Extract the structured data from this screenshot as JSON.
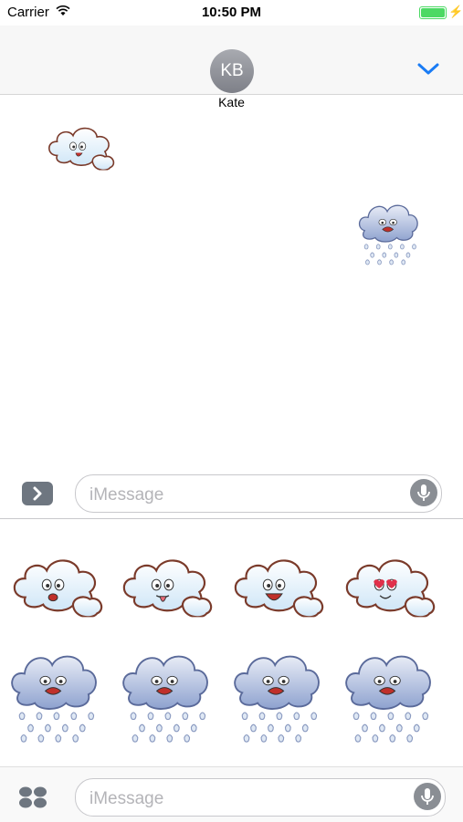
{
  "status_bar": {
    "carrier": "Carrier",
    "time": "10:50 PM"
  },
  "header": {
    "avatar_initials": "KB",
    "contact_name": "Kate"
  },
  "conversation": {
    "messages": [
      {
        "type": "sticker",
        "sender": "other",
        "icon": "cloud-puffing-sticker"
      },
      {
        "type": "sticker",
        "sender": "me",
        "icon": "rain-cloud-crying-sticker"
      }
    ]
  },
  "compose": {
    "placeholder": "iMessage",
    "placeholder_bottom": "iMessage"
  },
  "sticker_drawer": {
    "rows": [
      [
        "cloud-worried-sticker",
        "cloud-tongue-out-sticker",
        "cloud-laughing-sticker",
        "cloud-heart-eyes-sticker"
      ],
      [
        "rain-cloud-sad-sticker",
        "rain-cloud-shouting-sticker",
        "rain-cloud-angry-sticker",
        "rain-cloud-crying-sticker"
      ]
    ]
  },
  "colors": {
    "accent": "#1a7cf5",
    "battery": "#4cd964",
    "cloud_outline": "#7a3a2a"
  }
}
